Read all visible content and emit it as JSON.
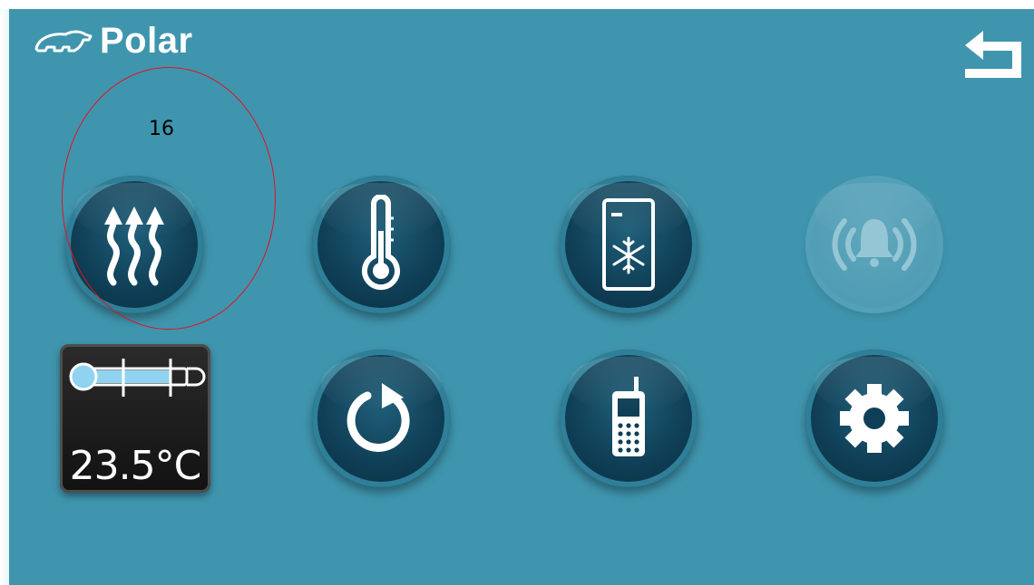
{
  "app": {
    "logo_text": "Polar"
  },
  "annotation": {
    "label": "16"
  },
  "menu": {
    "row1": [
      "heating-icon",
      "thermometer-icon",
      "freezer-icon",
      "alarm-bell-icon"
    ],
    "row2": [
      "temperature-display",
      "refresh-icon",
      "mobile-phone-icon",
      "gear-icon"
    ]
  },
  "temperature": {
    "value": "23.5°C"
  },
  "colors": {
    "background": "#3f95ae",
    "button_dark": "#0f3f56",
    "annotation": "#e0141e"
  }
}
